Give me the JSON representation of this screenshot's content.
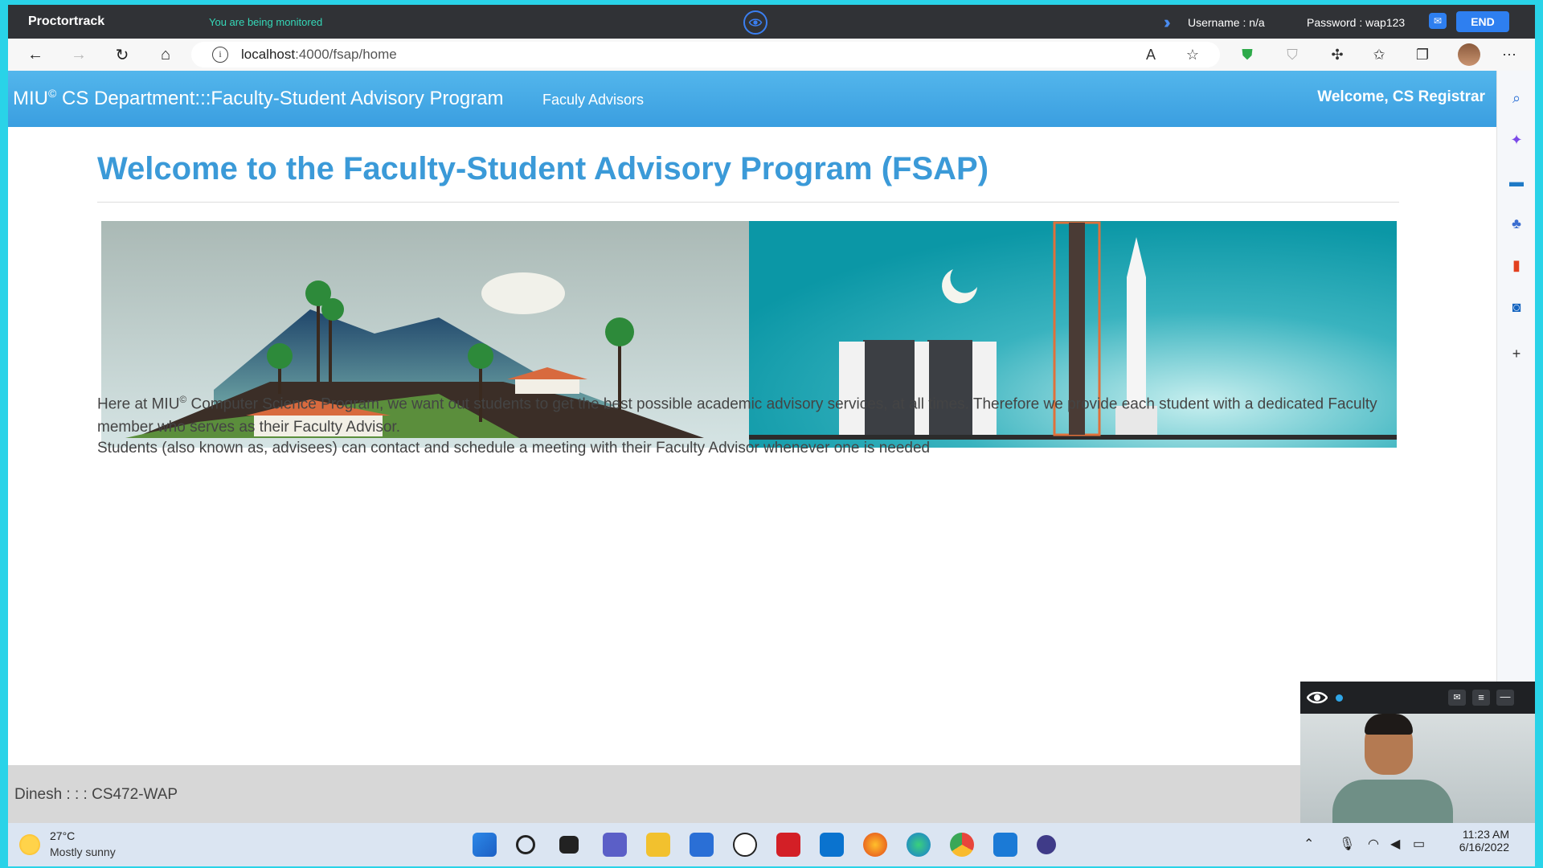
{
  "proctor": {
    "brand": "Proctortrack",
    "monitor_text": "You are being monitored",
    "username": "Username : n/a",
    "password": "Password : wap123",
    "end_label": "END"
  },
  "browser": {
    "url_host": "localhost",
    "url_path": ":4000/fsap/home"
  },
  "site": {
    "brand_prefix": "MIU",
    "brand_sup": "©",
    "brand_rest": " CS Department:::Faculty-Student Advisory Program",
    "nav_link": "Faculy Advisors",
    "welcome_user": "Welcome, CS Registrar",
    "title": "Welcome to the Faculty-Student Advisory Program (FSAP)",
    "para1_prefix": "Here at MIU",
    "para1_sup": "©",
    "para1_rest": " Computer Science Program, we want out students to get the best possible academic advisory services, at all times. Therefore we provide each student with a dedicated Faculty member who serves as their Faculty Advisor.",
    "para2": "Students (also known as, advisees) can contact and schedule a meeting with their Faculty Advisor whenever one is needed",
    "footer": "Dinesh : : : CS472-WAP"
  },
  "taskbar": {
    "temp": "27°C",
    "condition": "Mostly sunny",
    "time": "11:23 AM",
    "date": "6/16/2022"
  },
  "colors": {
    "frame": "#29d3e8",
    "navbar": "#3a9ee0",
    "title": "#3b9ad8",
    "proctor_accent": "#2e7ff0"
  }
}
